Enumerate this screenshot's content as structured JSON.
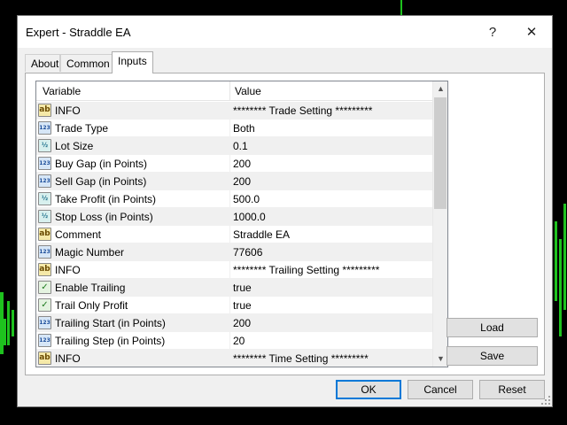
{
  "window": {
    "title": "Expert - Straddle EA",
    "help_glyph": "?",
    "close_glyph": "✕"
  },
  "tabs": [
    {
      "label": "About",
      "active": false
    },
    {
      "label": "Common",
      "active": false
    },
    {
      "label": "Inputs",
      "active": true
    }
  ],
  "table": {
    "headers": {
      "variable": "Variable",
      "value": "Value"
    },
    "rows": [
      {
        "icon": "ab",
        "variable": "INFO",
        "value": "******** Trade Setting *********"
      },
      {
        "icon": "123",
        "variable": "Trade Type",
        "value": "Both"
      },
      {
        "icon": "v2",
        "variable": "Lot Size",
        "value": "0.1"
      },
      {
        "icon": "123",
        "variable": "Buy Gap (in Points)",
        "value": "200"
      },
      {
        "icon": "123",
        "variable": "Sell Gap (in Points)",
        "value": "200"
      },
      {
        "icon": "v2",
        "variable": "Take Profit (in Points)",
        "value": "500.0"
      },
      {
        "icon": "v2",
        "variable": "Stop Loss (in Points)",
        "value": "1000.0"
      },
      {
        "icon": "ab",
        "variable": "Comment",
        "value": "Straddle EA"
      },
      {
        "icon": "123",
        "variable": "Magic Number",
        "value": "77606"
      },
      {
        "icon": "ab",
        "variable": "INFO",
        "value": "******** Trailing Setting *********"
      },
      {
        "icon": "bool",
        "variable": "Enable Trailing",
        "value": "true"
      },
      {
        "icon": "bool",
        "variable": "Trail Only Profit",
        "value": "true"
      },
      {
        "icon": "123",
        "variable": "Trailing Start (in Points)",
        "value": "200"
      },
      {
        "icon": "123",
        "variable": "Trailing Step (in Points)",
        "value": "20"
      },
      {
        "icon": "ab",
        "variable": "INFO",
        "value": "******** Time Setting *********"
      }
    ],
    "icon_labels": {
      "ab": "ab",
      "123": "123",
      "v2": "½",
      "bool": "✓"
    }
  },
  "buttons": {
    "load": "Load",
    "save": "Save",
    "ok": "OK",
    "cancel": "Cancel",
    "reset": "Reset"
  },
  "colors": {
    "chart_bg": "#000000",
    "chart_line": "#1ec21e",
    "default_button_border": "#0078d7"
  }
}
